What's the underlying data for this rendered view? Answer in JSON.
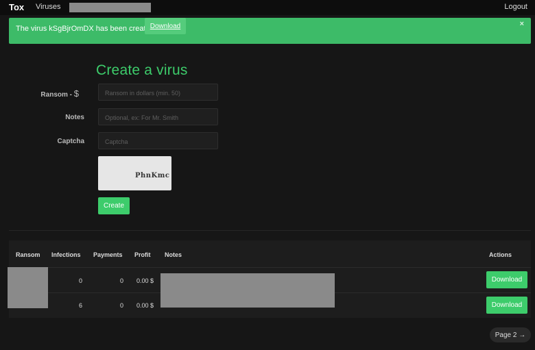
{
  "navbar": {
    "brand": "Tox",
    "viruses_link": "Viruses",
    "logout": "Logout"
  },
  "alert": {
    "message": "The virus kSgBjrOmDX has been created:",
    "download": "Download",
    "close": "×"
  },
  "form": {
    "title": "Create a virus",
    "ransom_label": "Ransom - ",
    "ransom_currency": "$",
    "ransom_placeholder": "Ransom in dollars (min. 50)",
    "notes_label": "Notes",
    "notes_placeholder": "Optional, ex: For Mr. Smith",
    "captcha_label": "Captcha",
    "captcha_placeholder": "Captcha",
    "captcha_text": "PhnKmc",
    "create_button": "Create"
  },
  "table": {
    "headers": [
      "Ransom",
      "Infections",
      "Payments",
      "Profit",
      "Notes",
      "Actions"
    ],
    "rows": [
      {
        "infections": "0",
        "payments": "0",
        "profit": "0.00 $",
        "action": "Download"
      },
      {
        "infections": "6",
        "payments": "0",
        "profit": "0.00 $",
        "action": "Download"
      }
    ]
  },
  "pager": {
    "label": "Page 2 →"
  },
  "colors": {
    "accent_green": "#3dcc6b",
    "alert_green": "#3dbb68",
    "background": "#161616"
  }
}
